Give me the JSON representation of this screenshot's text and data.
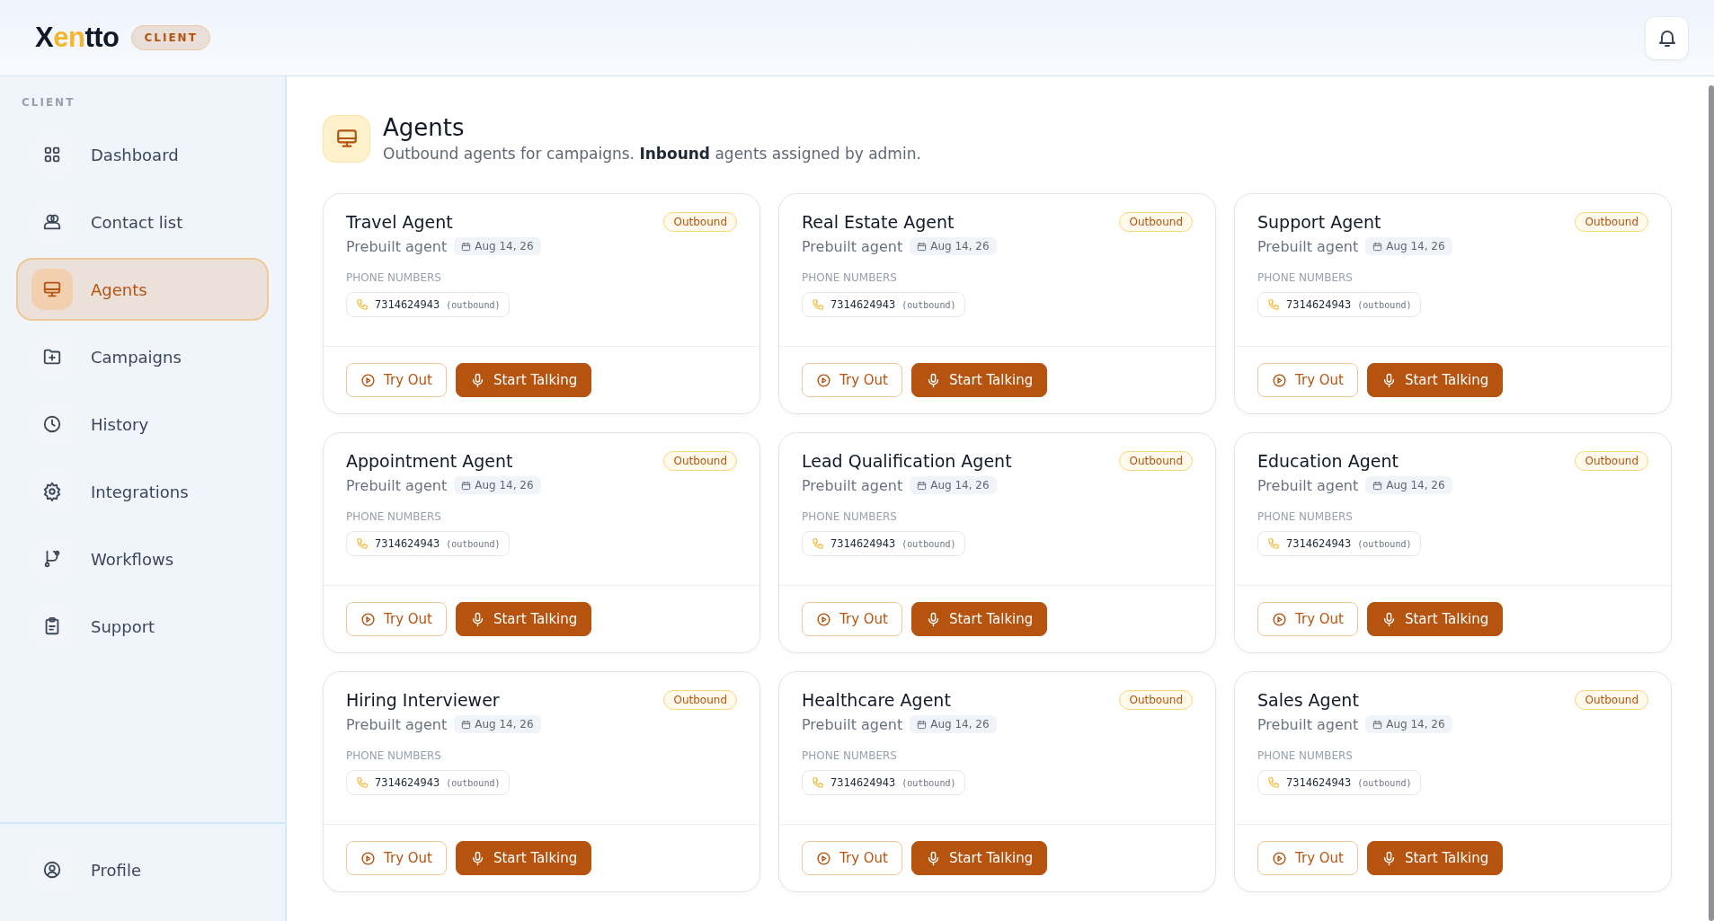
{
  "header": {
    "logo": [
      {
        "text": "X",
        "accent": false
      },
      {
        "text": "en",
        "accent": true
      },
      {
        "text": "tto",
        "accent": false
      }
    ],
    "role_badge": "CLIENT"
  },
  "sidebar": {
    "section_label": "CLIENT",
    "items": [
      {
        "label": "Dashboard",
        "kind": "grid",
        "selected": false
      },
      {
        "label": "Contact list",
        "kind": "users",
        "selected": false
      },
      {
        "label": "Agents",
        "kind": "monitor",
        "selected": true
      },
      {
        "label": "Campaigns",
        "kind": "folder",
        "selected": false
      },
      {
        "label": "History",
        "kind": "clock",
        "selected": false
      },
      {
        "label": "Integrations",
        "kind": "gear",
        "selected": false
      },
      {
        "label": "Workflows",
        "kind": "branch",
        "selected": false
      },
      {
        "label": "Support",
        "kind": "clipboard",
        "selected": false
      }
    ],
    "footer_item": {
      "label": "Profile",
      "kind": "user",
      "selected": false
    }
  },
  "page": {
    "title": "Agents",
    "subtitle": "Outbound agents for campaigns. **Inbound** agents assigned by admin."
  },
  "agents": [
    {
      "name": "Travel Agent",
      "badge": "Outbound",
      "type": "Prebuilt agent",
      "date": "Aug 14, 26",
      "phone_label": "PHONE NUMBERS",
      "phone": "7314624943",
      "direction": "(outbound)",
      "try_button": "Try Out",
      "talk_button": "Start Talking"
    },
    {
      "name": "Real Estate Agent",
      "badge": "Outbound",
      "type": "Prebuilt agent",
      "date": "Aug 14, 26",
      "phone_label": "PHONE NUMBERS",
      "phone": "7314624943",
      "direction": "(outbound)",
      "try_button": "Try Out",
      "talk_button": "Start Talking"
    },
    {
      "name": "Support Agent",
      "badge": "Outbound",
      "type": "Prebuilt agent",
      "date": "Aug 14, 26",
      "phone_label": "PHONE NUMBERS",
      "phone": "7314624943",
      "direction": "(outbound)",
      "try_button": "Try Out",
      "talk_button": "Start Talking"
    },
    {
      "name": "Appointment Agent",
      "badge": "Outbound",
      "type": "Prebuilt agent",
      "date": "Aug 14, 26",
      "phone_label": "PHONE NUMBERS",
      "phone": "7314624943",
      "direction": "(outbound)",
      "try_button": "Try Out",
      "talk_button": "Start Talking"
    },
    {
      "name": "Lead Qualification Agent",
      "badge": "Outbound",
      "type": "Prebuilt agent",
      "date": "Aug 14, 26",
      "phone_label": "PHONE NUMBERS",
      "phone": "7314624943",
      "direction": "(outbound)",
      "try_button": "Try Out",
      "talk_button": "Start Talking"
    },
    {
      "name": "Education Agent",
      "badge": "Outbound",
      "type": "Prebuilt agent",
      "date": "Aug 14, 26",
      "phone_label": "PHONE NUMBERS",
      "phone": "7314624943",
      "direction": "(outbound)",
      "try_button": "Try Out",
      "talk_button": "Start Talking"
    },
    {
      "name": "Hiring Interviewer",
      "badge": "Outbound",
      "type": "Prebuilt agent",
      "date": "Aug 14, 26",
      "phone_label": "PHONE NUMBERS",
      "phone": "7314624943",
      "direction": "(outbound)",
      "try_button": "Try Out",
      "talk_button": "Start Talking"
    },
    {
      "name": "Healthcare Agent",
      "badge": "Outbound",
      "type": "Prebuilt agent",
      "date": "Aug 14, 26",
      "phone_label": "PHONE NUMBERS",
      "phone": "7314624943",
      "direction": "(outbound)",
      "try_button": "Try Out",
      "talk_button": "Start Talking"
    },
    {
      "name": "Sales Agent",
      "badge": "Outbound",
      "type": "Prebuilt agent",
      "date": "Aug 14, 26",
      "phone_label": "PHONE NUMBERS",
      "phone": "7314624943",
      "direction": "(outbound)",
      "try_button": "Try Out",
      "talk_button": "Start Talking"
    }
  ]
}
